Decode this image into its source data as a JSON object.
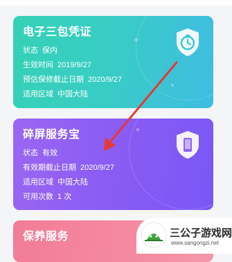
{
  "cards": [
    {
      "title": "电子三包凭证",
      "icon": "shield-clock-icon",
      "rows": [
        {
          "key": "状态",
          "value": "保内"
        },
        {
          "key": "生效时间",
          "value": "2019/9/27"
        },
        {
          "key": "预估保修截止日期",
          "value": "2020/9/27"
        },
        {
          "key": "适用区域",
          "value": "中国大陆"
        }
      ]
    },
    {
      "title": "碎屏服务宝",
      "icon": "shield-phone-icon",
      "rows": [
        {
          "key": "状态",
          "value": "有效"
        },
        {
          "key": "有效期截止日期",
          "value": "2020/9/27"
        },
        {
          "key": "适用区域",
          "value": "中国大陆"
        },
        {
          "key": "可用次数",
          "value": "1 次"
        }
      ]
    },
    {
      "title": "保养服务",
      "icon": "",
      "rows": []
    }
  ],
  "watermark": {
    "name": "三公子游戏网",
    "url": "www.sangongzi.net"
  },
  "colors": {
    "warranty": "#38cdc4",
    "screen": "#8a5cf4",
    "maintenance": "#f48aa0",
    "arrow": "#e53935"
  }
}
